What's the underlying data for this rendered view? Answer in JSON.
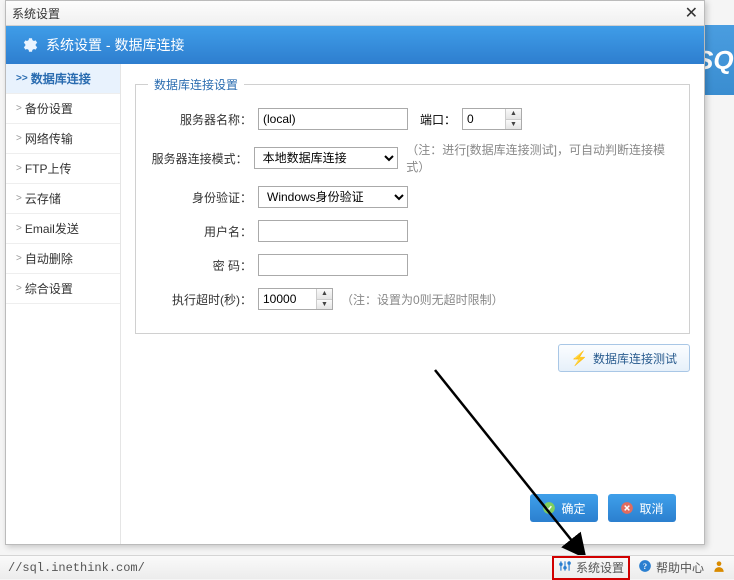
{
  "window": {
    "title": "系统设置"
  },
  "header": {
    "title": "系统设置 - 数据库连接"
  },
  "sidebar": {
    "items": [
      {
        "label": "数据库连接",
        "selected": true
      },
      {
        "label": "备份设置"
      },
      {
        "label": "网络传输"
      },
      {
        "label": "FTP上传"
      },
      {
        "label": "云存储"
      },
      {
        "label": "Email发送"
      },
      {
        "label": "自动删除"
      },
      {
        "label": "综合设置"
      }
    ]
  },
  "group": {
    "legend": "数据库连接设置"
  },
  "form": {
    "server_label": "服务器名称：",
    "server_value": "(local)",
    "port_label": "端口：",
    "port_value": "0",
    "mode_label": "服务器连接模式：",
    "mode_value": "本地数据库连接",
    "mode_note": "（注：进行[数据库连接测试]，可自动判断连接模式）",
    "auth_label": "身份验证：",
    "auth_value": "Windows身份验证",
    "user_label": "用户名：",
    "user_value": "",
    "pwd_label": "密  码：",
    "pwd_value": "",
    "timeout_label": "执行超时(秒)：",
    "timeout_value": "10000",
    "timeout_note": "（注：设置为0则无超时限制）"
  },
  "buttons": {
    "test": "数据库连接测试",
    "ok": "确定",
    "cancel": "取消"
  },
  "statusbar": {
    "url": "//sql.inethink.com/",
    "settings": "系统设置",
    "help": "帮助中心"
  },
  "backdrop": {
    "text": "SQ"
  }
}
